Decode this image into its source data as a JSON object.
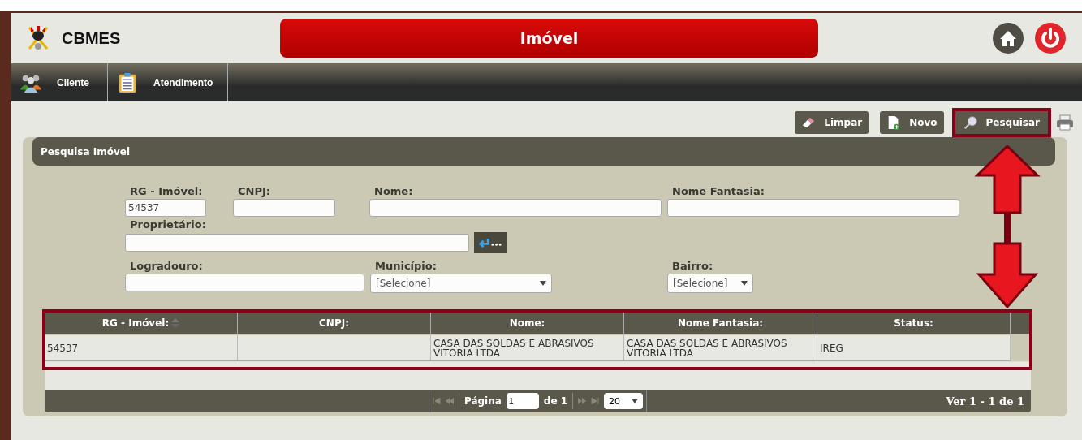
{
  "header": {
    "brand": "CBMES",
    "title": "Imóvel"
  },
  "nav": [
    {
      "label": "Cliente"
    },
    {
      "label": "Atendimento"
    }
  ],
  "toolbar": [
    {
      "label": "Limpar",
      "highlighted": false
    },
    {
      "label": "Novo",
      "highlighted": false
    },
    {
      "label": "Pesquisar",
      "highlighted": true
    }
  ],
  "panel": {
    "title": "Pesquisa Imóvel",
    "form_rows": [
      [
        {
          "label": "RG - Imóvel:",
          "kind": "text",
          "value": "54537"
        },
        {
          "label": "CNPJ:",
          "kind": "text"
        },
        {
          "label": "Nome:",
          "kind": "text"
        },
        {
          "label": "Nome Fantasia:",
          "kind": "text"
        }
      ],
      [
        {
          "label": "Proprietário:",
          "kind": "lookup"
        }
      ],
      [
        {
          "label": "Logradouro:",
          "kind": "text"
        },
        {
          "label": "Município:",
          "kind": "select",
          "value": "[Selecione]"
        },
        {
          "label": "Bairro:",
          "kind": "select",
          "value": "[Selecione]"
        }
      ]
    ],
    "table": {
      "highlighted": true,
      "columns": [
        "RG - Imóvel:",
        "CNPJ:",
        "Nome:",
        "Nome Fantasia:",
        "Status:"
      ],
      "rows": [
        [
          "54537",
          "",
          "CASA DAS SOLDAS E ABRASIVOS VITORIA LTDA",
          "CASA DAS SOLDAS E ABRASIVOS VITORIA LTDA",
          "IREG"
        ]
      ]
    },
    "pager": {
      "page_label": "Página",
      "page": "1",
      "of": "de 1",
      "page_size": "20",
      "summary": "Ver 1 - 1 de 1"
    }
  }
}
